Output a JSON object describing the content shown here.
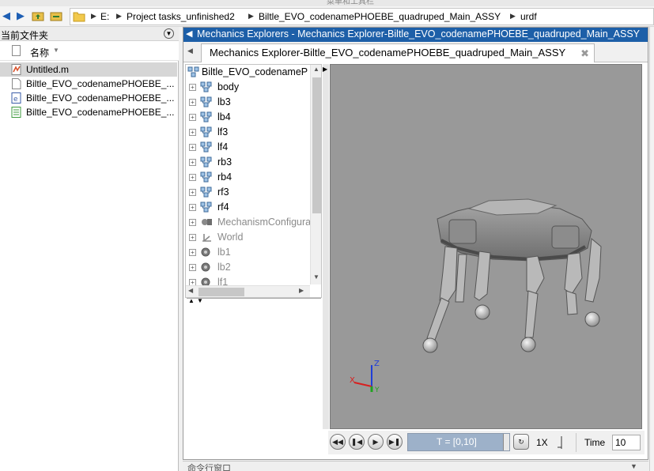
{
  "titlebar": {
    "text": "菜单和工具栏"
  },
  "address": {
    "crumbs": [
      "E:",
      "Project tasks_unfinished2",
      "Biltle_EVO_codenamePHOEBE_quadruped_Main_ASSY",
      "urdf"
    ]
  },
  "current_folder": {
    "title": "当前文件夹",
    "column_name": "名称",
    "files": [
      {
        "name": "Untitled.m",
        "icon": "matlab-script-icon",
        "selected": true
      },
      {
        "name": "Biltle_EVO_codenamePHOEBE_...",
        "icon": "blank-file-icon",
        "selected": false
      },
      {
        "name": "Biltle_EVO_codenamePHOEBE_...",
        "icon": "e-file-icon",
        "selected": false
      },
      {
        "name": "Biltle_EVO_codenamePHOEBE_...",
        "icon": "green-doc-icon",
        "selected": false
      }
    ]
  },
  "explorer": {
    "window_title": "Mechanics Explorers - Mechanics Explorer-Biltle_EVO_codenamePHOEBE_quadruped_Main_ASSY",
    "tab_label": "Mechanics Explorer-Biltle_EVO_codenamePHOEBE_quadruped_Main_ASSY",
    "tree_root": "Biltle_EVO_codenamePHOEBE_quadruped_Main_ASSY",
    "tree_items": [
      {
        "label": "body",
        "icon": "body-icon",
        "grey": false
      },
      {
        "label": "lb3",
        "icon": "body-icon",
        "grey": false
      },
      {
        "label": "lb4",
        "icon": "body-icon",
        "grey": false
      },
      {
        "label": "lf3",
        "icon": "body-icon",
        "grey": false
      },
      {
        "label": "lf4",
        "icon": "body-icon",
        "grey": false
      },
      {
        "label": "rb3",
        "icon": "body-icon",
        "grey": false
      },
      {
        "label": "rb4",
        "icon": "body-icon",
        "grey": false
      },
      {
        "label": "rf3",
        "icon": "body-icon",
        "grey": false
      },
      {
        "label": "rf4",
        "icon": "body-icon",
        "grey": false
      },
      {
        "label": "MechanismConfiguration",
        "icon": "mechanism-config-icon",
        "grey": true
      },
      {
        "label": "World",
        "icon": "world-frame-icon",
        "grey": true
      },
      {
        "label": "lb1",
        "icon": "revolute-joint-icon",
        "grey": true
      },
      {
        "label": "lb2",
        "icon": "revolute-joint-icon",
        "grey": true
      },
      {
        "label": "lf1",
        "icon": "revolute-joint-icon",
        "grey": true
      }
    ],
    "axes": {
      "x": "X",
      "y": "Y",
      "z": "Z"
    },
    "playback": {
      "time_range": "T = [0,10]",
      "speed": "1X",
      "time_label": "Time",
      "time_value": "10"
    }
  },
  "command_window": {
    "title": "命令行窗口"
  }
}
